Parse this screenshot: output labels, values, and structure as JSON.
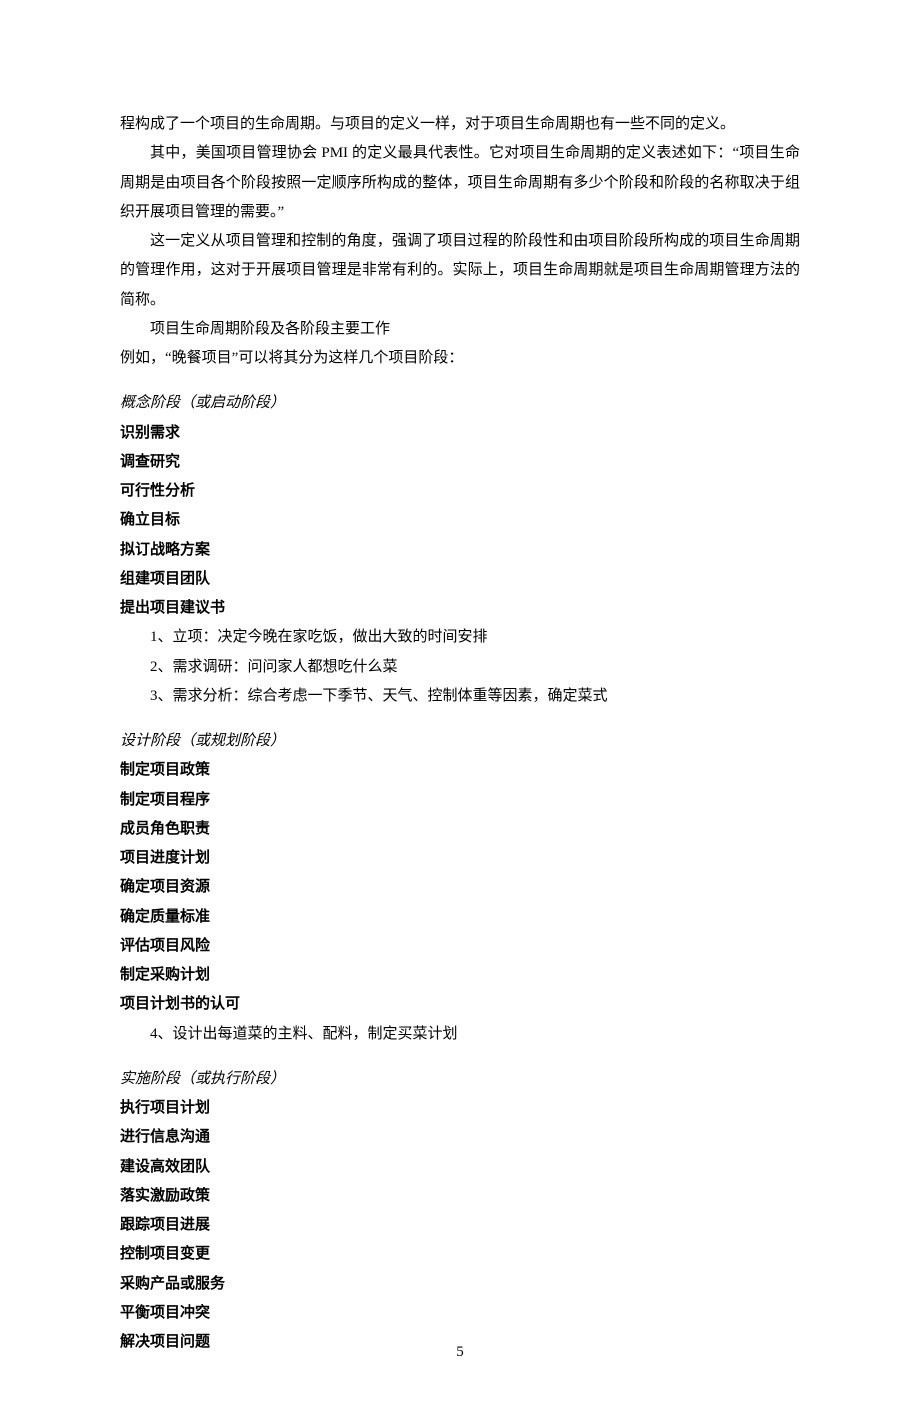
{
  "intro": {
    "p1": "程构成了一个项目的生命周期。与项目的定义一样，对于项目生命周期也有一些不同的定义。",
    "p2": "其中，美国项目管理协会 PMI 的定义最具代表性。它对项目生命周期的定义表述如下：“项目生命周期是由项目各个阶段按照一定顺序所构成的整体，项目生命周期有多少个阶段和阶段的名称取决于组织开展项目管理的需要。”",
    "p3": "这一定义从项目管理和控制的角度，强调了项目过程的阶段性和由项目阶段所构成的项目生命周期的管理作用，这对于开展项目管理是非常有利的。实际上，项目生命周期就是项目生命周期管理方法的简称。",
    "p4": "项目生命周期阶段及各阶段主要工作",
    "p5": "例如，“晚餐项目”可以将其分为这样几个项目阶段："
  },
  "phase1": {
    "title": "概念阶段（或启动阶段）",
    "items": {
      "i1": "识别需求",
      "i2": "调查研究",
      "i3": "可行性分析",
      "i4": "确立目标",
      "i5": "拟订战略方案",
      "i6": "组建项目团队",
      "i7": "提出项目建议书"
    },
    "num": {
      "n1": "1、立项：决定今晚在家吃饭，做出大致的时间安排",
      "n2": "2、需求调研：问问家人都想吃什么菜",
      "n3": "3、需求分析：综合考虑一下季节、天气、控制体重等因素，确定菜式"
    }
  },
  "phase2": {
    "title": "设计阶段（或规划阶段）",
    "items": {
      "i1": "制定项目政策",
      "i2": "制定项目程序",
      "i3": "成员角色职责",
      "i4": "项目进度计划",
      "i5": "确定项目资源",
      "i6": "确定质量标准",
      "i7": "评估项目风险",
      "i8": "制定采购计划",
      "i9": "项目计划书的认可"
    },
    "num": {
      "n1": "4、设计出每道菜的主料、配料，制定买菜计划"
    }
  },
  "phase3": {
    "title": "实施阶段（或执行阶段）",
    "items": {
      "i1": "执行项目计划",
      "i2": "进行信息沟通",
      "i3": "建设高效团队",
      "i4": "落实激励政策",
      "i5": "跟踪项目进展",
      "i6": "控制项目变更",
      "i7": "采购产品或服务",
      "i8": "平衡项目冲突",
      "i9": "解决项目问题"
    }
  },
  "pageNumber": "5"
}
